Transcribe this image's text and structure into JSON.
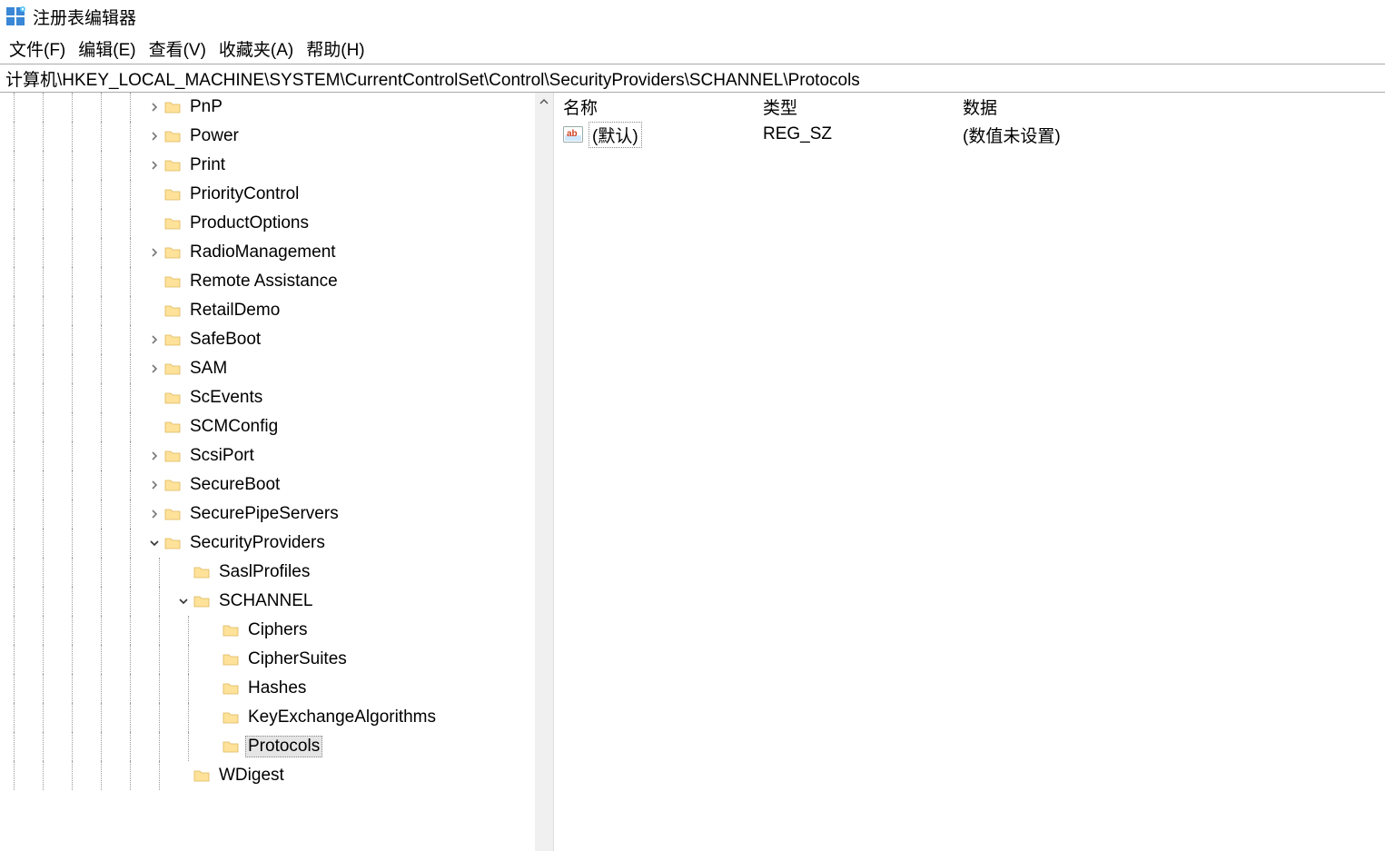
{
  "app": {
    "title": "注册表编辑器"
  },
  "menu": {
    "file": "文件(F)",
    "edit": "编辑(E)",
    "view": "查看(V)",
    "favorites": "收藏夹(A)",
    "help": "帮助(H)"
  },
  "address": "计算机\\HKEY_LOCAL_MACHINE\\SYSTEM\\CurrentControlSet\\Control\\SecurityProviders\\SCHANNEL\\Protocols",
  "tree": {
    "nodes": [
      {
        "depth": 5,
        "expander": "right",
        "label": "PnP"
      },
      {
        "depth": 5,
        "expander": "right",
        "label": "Power"
      },
      {
        "depth": 5,
        "expander": "right",
        "label": "Print"
      },
      {
        "depth": 5,
        "expander": "none",
        "label": "PriorityControl"
      },
      {
        "depth": 5,
        "expander": "none",
        "label": "ProductOptions"
      },
      {
        "depth": 5,
        "expander": "right",
        "label": "RadioManagement"
      },
      {
        "depth": 5,
        "expander": "none",
        "label": "Remote Assistance"
      },
      {
        "depth": 5,
        "expander": "none",
        "label": "RetailDemo"
      },
      {
        "depth": 5,
        "expander": "right",
        "label": "SafeBoot"
      },
      {
        "depth": 5,
        "expander": "right",
        "label": "SAM"
      },
      {
        "depth": 5,
        "expander": "none",
        "label": "ScEvents"
      },
      {
        "depth": 5,
        "expander": "none",
        "label": "SCMConfig"
      },
      {
        "depth": 5,
        "expander": "right",
        "label": "ScsiPort"
      },
      {
        "depth": 5,
        "expander": "right",
        "label": "SecureBoot"
      },
      {
        "depth": 5,
        "expander": "right",
        "label": "SecurePipeServers"
      },
      {
        "depth": 5,
        "expander": "down",
        "label": "SecurityProviders"
      },
      {
        "depth": 6,
        "expander": "none",
        "label": "SaslProfiles"
      },
      {
        "depth": 6,
        "expander": "down",
        "label": "SCHANNEL"
      },
      {
        "depth": 7,
        "expander": "none",
        "label": "Ciphers"
      },
      {
        "depth": 7,
        "expander": "none",
        "label": "CipherSuites"
      },
      {
        "depth": 7,
        "expander": "none",
        "label": "Hashes"
      },
      {
        "depth": 7,
        "expander": "none",
        "label": "KeyExchangeAlgorithms"
      },
      {
        "depth": 7,
        "expander": "none",
        "label": "Protocols",
        "selected": true
      },
      {
        "depth": 6,
        "expander": "none",
        "label": "WDigest"
      }
    ]
  },
  "list": {
    "columns": {
      "name": "名称",
      "type": "类型",
      "data": "数据"
    },
    "rows": [
      {
        "name": "(默认)",
        "type": "REG_SZ",
        "data": "(数值未设置)"
      }
    ]
  }
}
